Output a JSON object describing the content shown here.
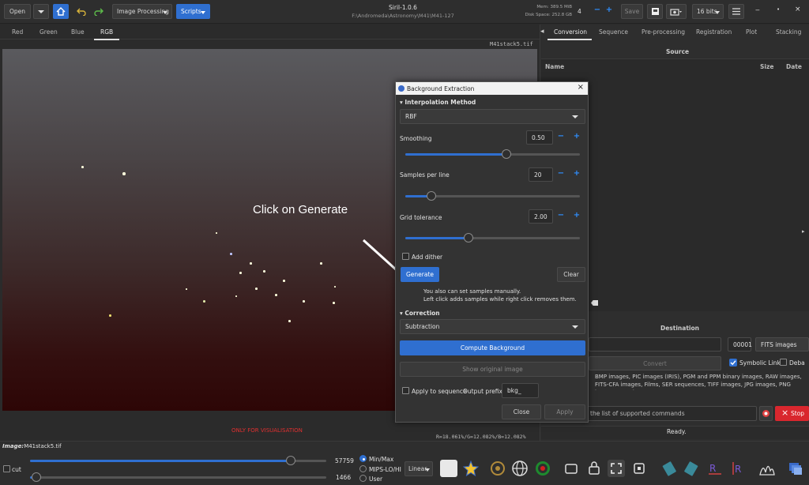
{
  "header": {
    "open_label": "Open",
    "image_processing_label": "Image Processing",
    "scripts_label": "Scripts",
    "app_title": "Siril-1.0.6",
    "app_path": "F:\\Andromeda\\Astronomy\\M41\\M41-127",
    "mem_label": "Mem: 389.5 MiB",
    "disk_label": "Disk Space: 252.8 GB",
    "threads_value": "4",
    "save_label": "Save",
    "bits_label": "16 bits"
  },
  "image_tabs": [
    "Red",
    "Green",
    "Blue",
    "RGB"
  ],
  "image_area": {
    "filename": "M41stack5.tif",
    "annotation": "Click on Generate",
    "visualisation_notice": "ONLY FOR VISUALISATION",
    "pixel_readout": "R=18.061%/G=12.082%/B=12.082%"
  },
  "right_panel": {
    "tabs": [
      "Conversion",
      "Sequence",
      "Pre-processing",
      "Registration",
      "Plot",
      "Stacking"
    ],
    "source_header": "Source",
    "col_name": "Name",
    "col_size": "Size",
    "col_date": "Date",
    "destination_header": "Destination",
    "index_value": "00001",
    "format_value": "FITS images",
    "convert_label": "Convert",
    "symbolic_link_label": "Symbolic Link",
    "debayer_label": "Deba",
    "supported_text": "BMP images, PIC images (IRIS), PGM and PPM binary images, RAW images, FITS-CFA images, Films, SER sequences, TIFF images, JPG images, PNG images, HEIF images",
    "command_placeholder": "the list of supported commands",
    "stop_label": "Stop",
    "status_text": "Ready."
  },
  "dialog": {
    "title": "Background Extraction",
    "interpolation_header": "Interpolation Method",
    "interpolation_value": "RBF",
    "smoothing_label": "Smoothing",
    "smoothing_value": "0.50",
    "smoothing_level": 0.58,
    "samples_label": "Samples per line",
    "samples_value": "20",
    "samples_level": 0.15,
    "tolerance_label": "Grid tolerance",
    "tolerance_value": "2.00",
    "tolerance_level": 0.36,
    "add_dither_label": "Add dither",
    "generate_label": "Generate",
    "clear_label": "Clear",
    "hint_line1": "You also can set samples manually.",
    "hint_line2": "Left click adds samples while right click removes them.",
    "correction_header": "Correction",
    "correction_value": "Subtraction",
    "compute_label": "Compute Background",
    "show_original_label": "Show original image",
    "apply_sequence_label": "Apply to sequence",
    "output_prefix_label": "Output prefix:",
    "output_prefix_value": "bkg_",
    "close_label": "Close",
    "apply_label": "Apply"
  },
  "bottom_bar": {
    "image_label": "Image:",
    "image_name": "M41stack5.tif",
    "cut_label": "cut",
    "high_value": "57759",
    "low_value": "1466",
    "high_level": 0.88,
    "low_level": 0.02,
    "mode_minmax": "Min/Max",
    "mode_mips": "MIPS-LO/HI",
    "mode_user": "User",
    "stretch_value": "Linear"
  },
  "colors": {
    "accent": "#2f6fd0",
    "stop_red": "#d9272e",
    "notice_red": "#e03030"
  }
}
